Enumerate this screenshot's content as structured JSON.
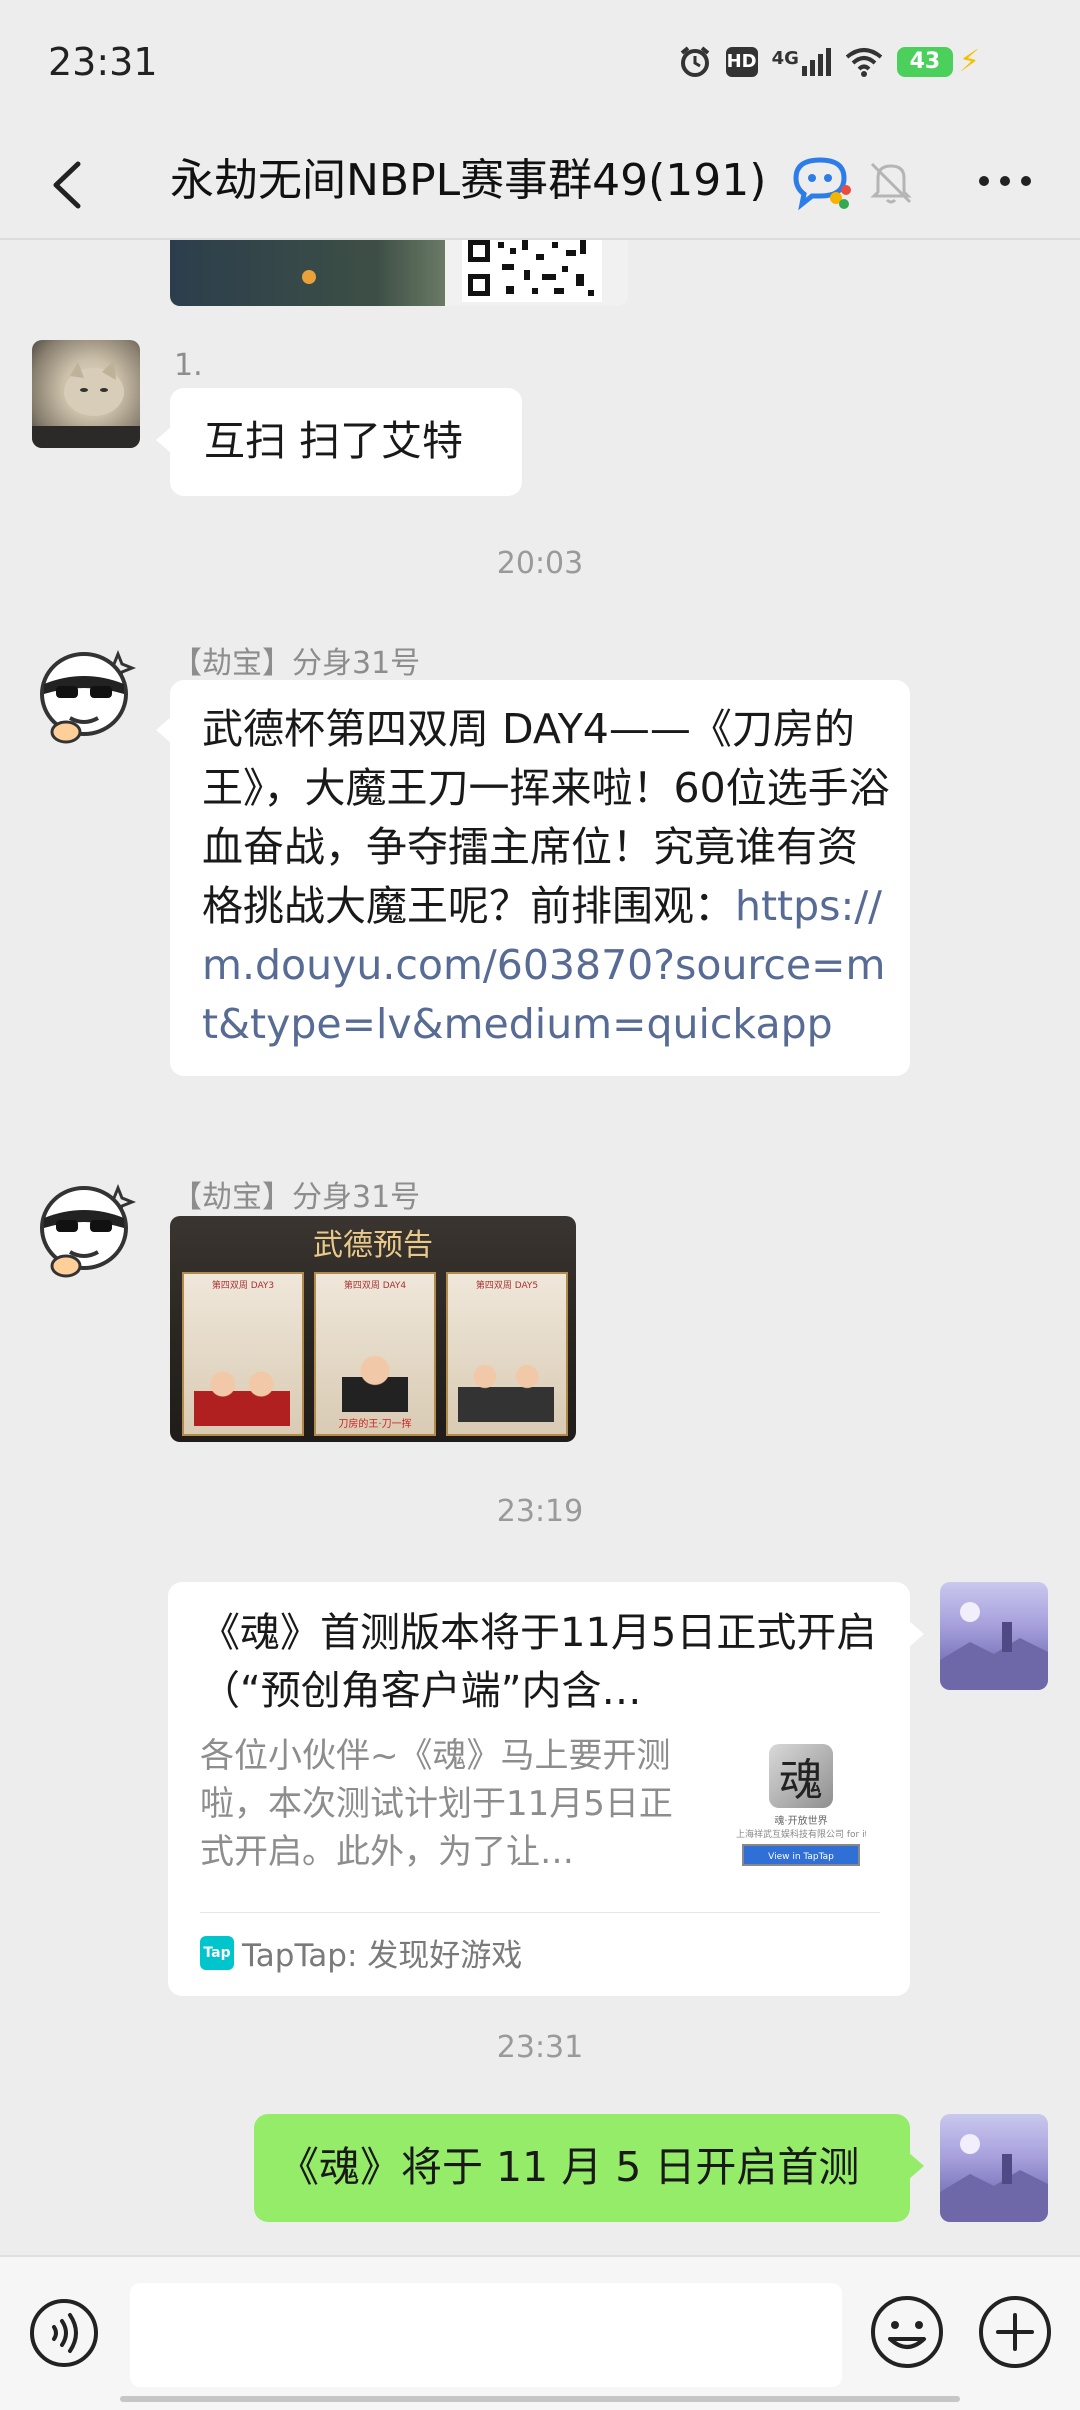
{
  "status_bar": {
    "time": "23:31",
    "hd_label": "HD",
    "network_label": "4G",
    "battery_level": "43"
  },
  "nav": {
    "title": "永劫无间NBPL赛事群49(191)"
  },
  "messages": {
    "m1": {
      "sender": "1.",
      "text": "互扫 扫了艾特"
    },
    "t1": "20:03",
    "m2": {
      "sender": "【劫宝】分身31号",
      "text": "武德杯第四双周 DAY4——《刀房的王》，大魔王刀一挥来啦！60位选手浴血奋战，争夺擂主席位！究竟谁有资格挑战大魔王呢？前排围观：",
      "link": "https://m.douyu.com/603870?source=mt&type=lv&medium=quickapp"
    },
    "m3": {
      "sender": "【劫宝】分身31号",
      "image": {
        "title": "武德预告",
        "panel1": "第四双周 DAY3",
        "panel2": "第四双周 DAY4",
        "panel3": "第四双周 DAY5",
        "panel2_caption": "刀房的王·刀一挥"
      }
    },
    "t2": "23:19",
    "m4": {
      "title": "《魂》首测版本将于11月5日正式开启（“预创角客户端”内含…",
      "desc": "各位小伙伴~《魂》马上要开测啦，本次测试计划于11月5日正式开启。此外，为了让…",
      "source": "TapTap: 发现好游戏",
      "source_logo": "Tap",
      "thumb_caption1": "魂·开放世界",
      "thumb_caption2": "上海祥武互娱科技有限公司 for it",
      "thumb_button": "View in TapTap"
    },
    "t3": "23:31",
    "m5": {
      "text": "《魂》将于 11 月 5 日开启首测"
    }
  },
  "input": {
    "placeholder": ""
  },
  "colors": {
    "background": "#ededed",
    "bubble_self": "#95ec69",
    "link": "#576b95",
    "battery": "#4cd05c"
  },
  "icons": [
    "back-icon",
    "group-icon",
    "mute-icon",
    "more-icon",
    "voice-icon",
    "emoji-icon",
    "plus-icon"
  ]
}
